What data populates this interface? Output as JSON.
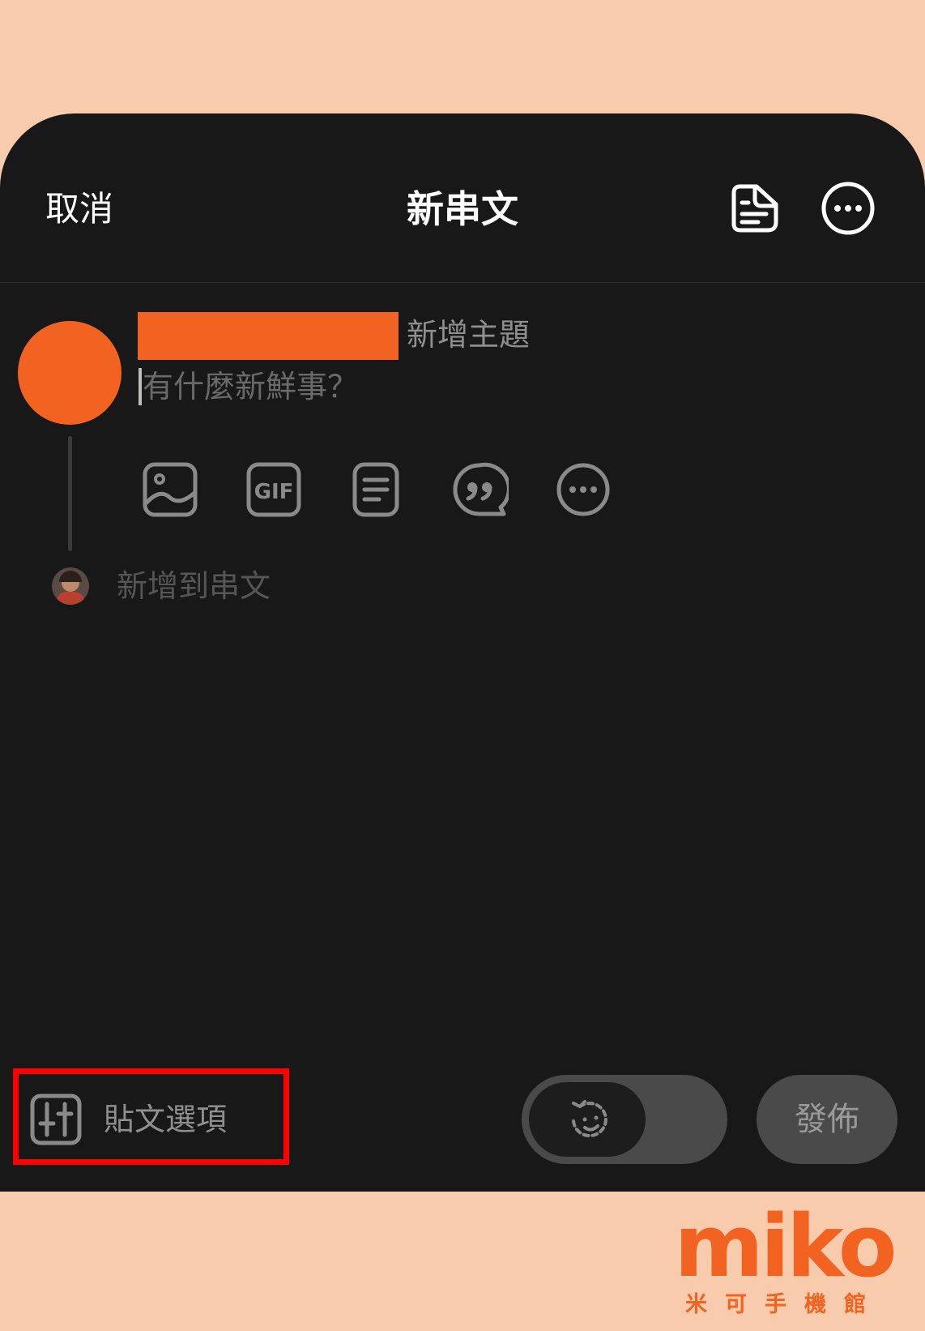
{
  "header": {
    "cancel_label": "取消",
    "title": "新串文",
    "icons": [
      "draft-icon",
      "more-options-icon"
    ]
  },
  "composer": {
    "username": "",
    "topic_label": "新增主題",
    "placeholder": "有什麼新鮮事？",
    "tools": [
      "image-icon",
      "gif-icon",
      "list-icon",
      "quote-icon",
      "more-icon"
    ],
    "add_to_thread_label": "新增到串文"
  },
  "footer": {
    "post_options_label": "貼文選項",
    "publish_label": "發佈",
    "toggle_icon": "ai-face-icon"
  },
  "watermark": {
    "logo_text": "miko",
    "subtitle": "米可手機館"
  },
  "colors": {
    "background": "#f8cbad",
    "sheet": "#181818",
    "brand_orange": "#f26322",
    "highlight_red": "#ff0000"
  }
}
